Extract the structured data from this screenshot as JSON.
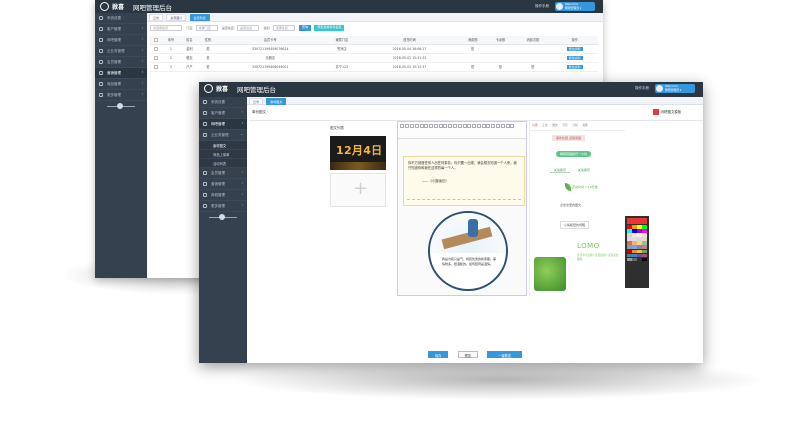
{
  "app": {
    "brand": "掀喜",
    "title": "网吧管理后台",
    "help": "操作手册",
    "user_name": "Welcome",
    "user_role": "网吧管理员 ▾"
  },
  "back": {
    "tabs": [
      "云市",
      "资源图片",
      "会员列表"
    ],
    "sidebar": [
      "系统设置",
      "客户管理",
      "网吧管理",
      "云业务管理",
      "会员管理",
      "营销管理",
      "商品管理",
      "更多管理"
    ],
    "filter": {
      "f1": "请选择会员",
      "l2": "门店:",
      "f2": "选择门店",
      "l3": "是否在店:",
      "f3": "是否在店",
      "l4": "性别:",
      "f4": "选择性别",
      "search": "查询",
      "export": "导出当前条件会员"
    },
    "headers": [
      "",
      "序号",
      "姓名",
      "性别",
      "会员卡号",
      "隶属门店",
      "首充时间",
      "消费额",
      "卡余额",
      "消费次数",
      "操作"
    ],
    "rows": [
      [
        "1",
        "金利",
        "男",
        "330721199409076624",
        "苍凉店",
        "2016-05-04 16:06:17",
        "是",
        "",
        "",
        "修改资料"
      ],
      [
        "2",
        "璐瓦",
        "男",
        "元朗店",
        "",
        "2016-05-02 15:41:33",
        "",
        "",
        "",
        "修改资料"
      ],
      [
        "3",
        "户户",
        "男",
        "330721199406049001",
        "苏宁123",
        "2016-05-02 15:12:37",
        "是",
        "是",
        "是",
        "修改资料"
      ]
    ]
  },
  "front": {
    "tabs": [
      "云市",
      "素材图文"
    ],
    "sidebar": [
      "系统设置",
      "客户管理",
      "网吧管理",
      "云业务管理",
      "素材图文",
      "商品上架单",
      "活动列表",
      "会员管理",
      "营销管理",
      "商城管理",
      "更多管理"
    ],
    "section": "单份图文",
    "template_btn": "网吧图文模板",
    "cover_label": "图文列表",
    "cover_date": "12月4日",
    "quote_text": "你不方到做任何人出任何事情。你只要一出现，我会想去知道一个人来，我只知道你和我在这样的每一个人。",
    "quote_sig": "——《小窗幽记》",
    "circle_text": "我是为和只是气，特别优秀的新家都。事情较多，很温暖的。如何结局是温情。",
    "style_tabs": [
      "标题",
      "正文",
      "图文",
      "引导",
      "分割",
      "其他"
    ],
    "styles": [
      "事件标题 点我来插",
      "网吧营销技巧一小时",
      "关注我们",
      "关注我们",
      "活动时间 7.10开始",
      "点击这里的图文",
      "心情暖阳的闲暇",
      "LOMO",
      "生活中不是缺少美而是缺少发现美的眼睛"
    ],
    "btn_save": "保存",
    "btn_preview": "预览",
    "btn_publish": "一键群发"
  },
  "palette_colors": [
    "#ff0000",
    "#ff9900",
    "#ffff00",
    "#00ff00",
    "#00ffff",
    "#0000ff",
    "#9900ff",
    "#ff00ff",
    "#f4cccc",
    "#fce5cd",
    "#fff2cc",
    "#d9ead3",
    "#d0e0e3",
    "#cfe2f3",
    "#d9d2e9",
    "#ead1dc",
    "#e06666",
    "#f6b26b",
    "#ffd966",
    "#93c47d",
    "#76a5af",
    "#6fa8dc",
    "#8e7cc3",
    "#c27ba0",
    "#cc0000",
    "#e69138",
    "#f1c232",
    "#6aa84f",
    "#45818e",
    "#3d85c6",
    "#674ea7",
    "#a64d79",
    "#999999",
    "#666666",
    "#333333",
    "#000000"
  ]
}
